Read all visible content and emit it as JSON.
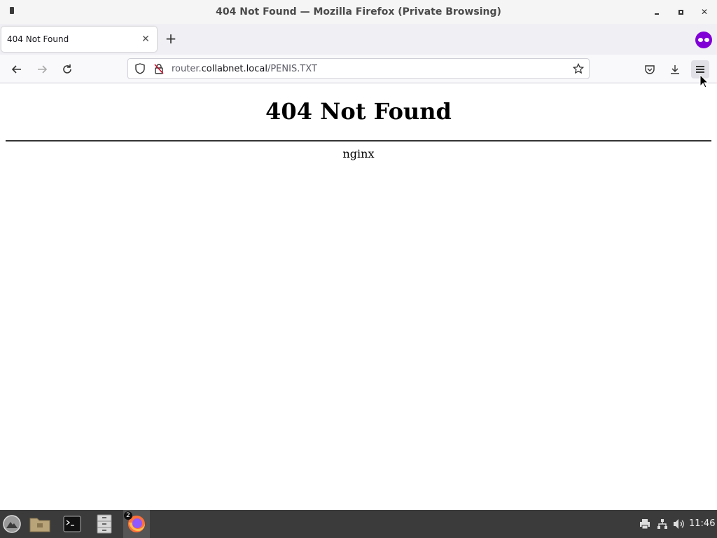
{
  "window": {
    "title": "404 Not Found — Mozilla Firefox (Private Browsing)"
  },
  "tabs": [
    {
      "label": "404 Not Found",
      "active": true
    }
  ],
  "navbar": {
    "url_host_prefix": "router.",
    "url_host": "collabnet.local",
    "url_path": "/PENIS.TXT"
  },
  "page": {
    "heading": "404 Not Found",
    "server": "nginx"
  },
  "taskbar": {
    "firefox_badge": "2",
    "clock": "11:46"
  },
  "colors": {
    "private_purple": "#8000d7",
    "taskbar_bg": "#3b3b3b"
  }
}
